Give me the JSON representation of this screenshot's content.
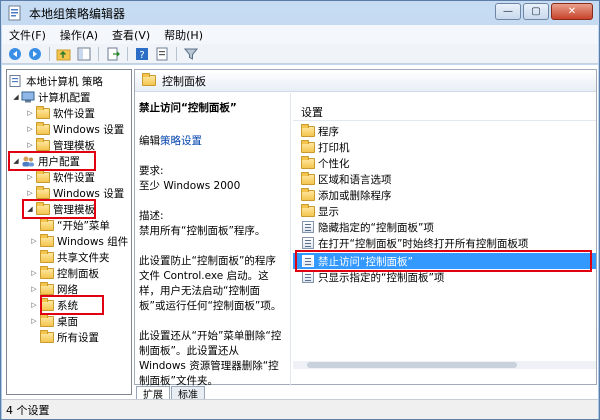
{
  "window": {
    "title": "本地组策略编辑器",
    "controls": {
      "minimize": "—",
      "maximize": "▢",
      "close": "✕"
    }
  },
  "menu": [
    "文件(F)",
    "操作(A)",
    "查看(V)",
    "帮助(H)"
  ],
  "toolbar": {
    "icons": [
      "back-arrow-icon",
      "forward-arrow-icon",
      "up-folder-icon",
      "show-hide-tree-icon",
      "export-list-icon",
      "help-icon",
      "properties-icon",
      "filter-icon"
    ]
  },
  "tree": {
    "items": [
      {
        "label": "本地计算机 策略",
        "level": 0,
        "expanded": true
      },
      {
        "label": "计算机配置",
        "level": 1,
        "expanded": true
      },
      {
        "label": "软件设置",
        "level": 2,
        "expanded": false
      },
      {
        "label": "Windows 设置",
        "level": 2,
        "expanded": false
      },
      {
        "label": "管理模板",
        "level": 2,
        "expanded": false
      },
      {
        "label": "用户配置",
        "level": 1,
        "expanded": true,
        "highlighted": true
      },
      {
        "label": "软件设置",
        "level": 2,
        "expanded": false
      },
      {
        "label": "Windows 设置",
        "level": 2,
        "expanded": false
      },
      {
        "label": "管理模板",
        "level": 2,
        "expanded": true,
        "highlighted": true
      },
      {
        "label": "“开始”菜单",
        "level": 3,
        "expanded": false
      },
      {
        "label": "Windows 组件",
        "level": 3,
        "expanded": false
      },
      {
        "label": "共享文件夹",
        "level": 3,
        "expanded": false
      },
      {
        "label": "控制面板",
        "level": 3,
        "expanded": false
      },
      {
        "label": "网络",
        "level": 3,
        "expanded": false
      },
      {
        "label": "系统",
        "level": 3,
        "expanded": false,
        "highlighted": true
      },
      {
        "label": "桌面",
        "level": 3,
        "expanded": false
      },
      {
        "label": "所有设置",
        "level": 3,
        "expanded": false
      }
    ]
  },
  "pane": {
    "header": "控制面板",
    "description": {
      "title": "禁止访问“控制面板”",
      "edit_prefix": "编辑",
      "edit_link": "策略设置",
      "requirements_label": "要求:",
      "requirements_value": "至少 Windows 2000",
      "desc_label": "描述:",
      "desc_line1": "禁用所有“控制面板”程序。",
      "para1": "此设置防止“控制面板”的程序文件 Control.exe 启动。这样，用户无法启动“控制面板”或运行任何“控制面板”项。",
      "para2": "此设置还从“开始”菜单删除“控制面板”。此设置还从 Windows 资源管理器删除“控制面板”文件夹。"
    },
    "column_header": "设置",
    "rows": [
      {
        "label": "程序",
        "type": "folder"
      },
      {
        "label": "打印机",
        "type": "folder"
      },
      {
        "label": "个性化",
        "type": "folder"
      },
      {
        "label": "区域和语言选项",
        "type": "folder"
      },
      {
        "label": "添加或删除程序",
        "type": "folder"
      },
      {
        "label": "显示",
        "type": "folder"
      },
      {
        "label": "隐藏指定的“控制面板”项",
        "type": "setting"
      },
      {
        "label": "在打开“控制面板”时始终打开所有控制面板项",
        "type": "setting"
      },
      {
        "label": "禁止访问“控制面板”",
        "type": "setting",
        "selected": true,
        "highlighted": true
      },
      {
        "label": "只显示指定的“控制面板”项",
        "type": "setting"
      }
    ]
  },
  "tabs": [
    "扩展",
    "标准"
  ],
  "status": "4 个设置",
  "colors": {
    "highlight_box": "#e10012",
    "selection": "#3399ff",
    "title_bg": "#c7dcf2",
    "link": "#0645ad"
  }
}
